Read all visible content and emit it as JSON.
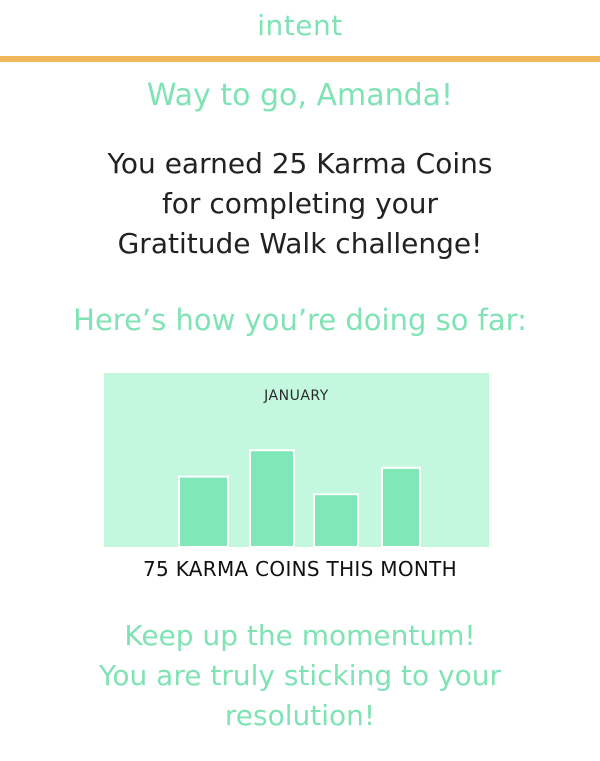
{
  "header": {
    "brand": "intent"
  },
  "greeting": "Way to go, Amanda!",
  "message": {
    "line1": "You earned 25 Karma Coins",
    "line2": "for completing your",
    "line3": "Gratitude Walk challenge!"
  },
  "subhead": "Here’s how you’re doing so far:",
  "chart_data": {
    "type": "bar",
    "title": "JANUARY",
    "categories": [
      "",
      "",
      "",
      ""
    ],
    "values": [
      16,
      22,
      12,
      18
    ],
    "ylim": [
      0,
      30
    ],
    "grid": false,
    "colors": {
      "background": "#c3f8df",
      "bar": "#80e8b8"
    }
  },
  "chart_caption": "75 KARMA COINS THIS MONTH",
  "encouragement": {
    "line1": "Keep up the momentum!",
    "line2": "You are truly sticking to your",
    "line3": "resolution!"
  },
  "colors": {
    "accent": "#7fe3b4",
    "rule": "#f1b85a",
    "text": "#222222"
  }
}
